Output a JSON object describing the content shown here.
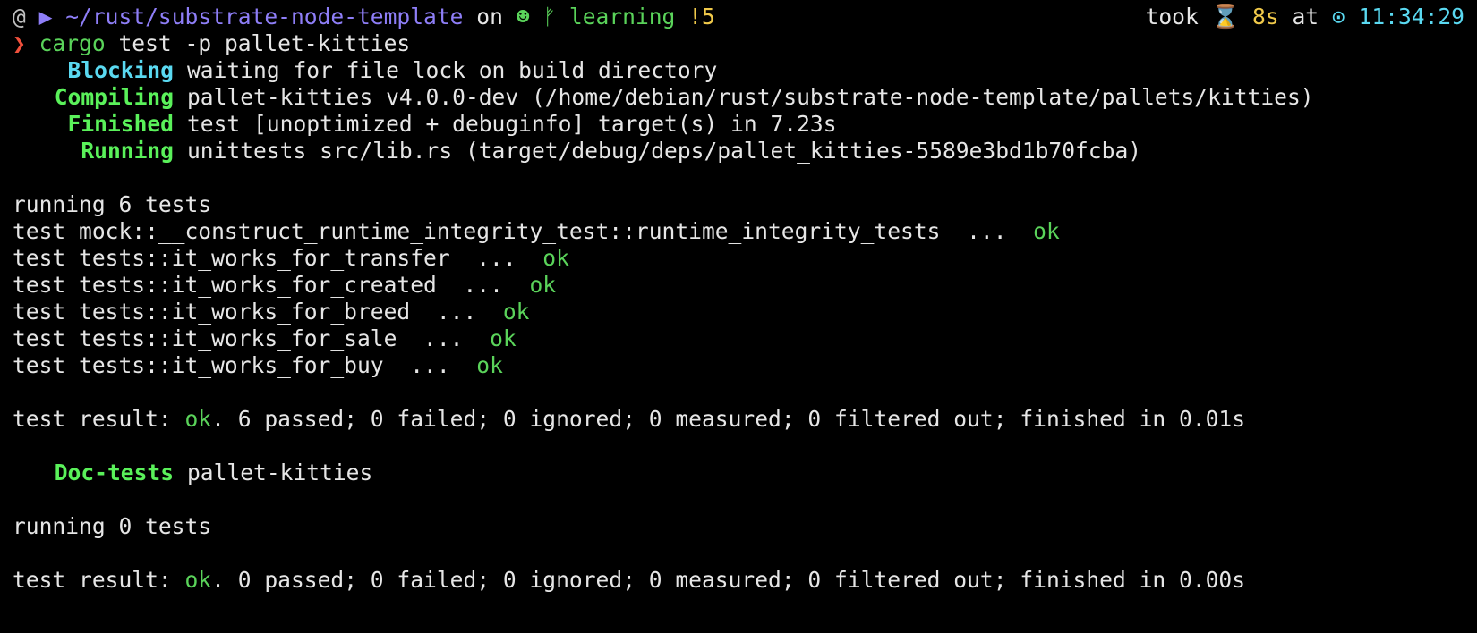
{
  "prompt": {
    "os_glyph": "@",
    "folder_glyph": "▶",
    "path": "~/rust/substrate-node-template",
    "on_word": "on",
    "git_glyph": "☻",
    "branch_glyph": "ᚠ",
    "branch": "learning",
    "status": "!5",
    "took_word": "took",
    "hourglass_glyph": "⌛",
    "duration": "8s",
    "at_word": "at",
    "clock_glyph": "⊙",
    "time": "11:34:29",
    "arrow_glyph": "❯",
    "command": "cargo",
    "args": "test -p pallet-kitties"
  },
  "cargo_status": [
    {
      "label": "Blocking",
      "text": "waiting for file lock on build directory",
      "color": "cyan"
    },
    {
      "label": "Compiling",
      "text": "pallet-kitties v4.0.0-dev (/home/debian/rust/substrate-node-template/pallets/kitties)",
      "color": "green"
    },
    {
      "label": "Finished",
      "text": "test [unoptimized + debuginfo] target(s) in 7.23s",
      "color": "green"
    },
    {
      "label": "Running",
      "text": "unittests src/lib.rs (target/debug/deps/pallet_kitties-5589e3bd1b70fcba)",
      "color": "green"
    }
  ],
  "unit_tests": {
    "running": "running 6 tests",
    "tests": [
      {
        "name": "test mock::__construct_runtime_integrity_test::runtime_integrity_tests",
        "dots": "...",
        "result": "ok"
      },
      {
        "name": "test tests::it_works_for_transfer",
        "dots": "...",
        "result": "ok"
      },
      {
        "name": "test tests::it_works_for_created",
        "dots": "...",
        "result": "ok"
      },
      {
        "name": "test tests::it_works_for_breed",
        "dots": "...",
        "result": "ok"
      },
      {
        "name": "test tests::it_works_for_sale",
        "dots": "...",
        "result": "ok"
      },
      {
        "name": "test tests::it_works_for_buy",
        "dots": "...",
        "result": "ok"
      }
    ],
    "result_prefix": "test result: ",
    "result_status": "ok",
    "result_rest": ". 6 passed; 0 failed; 0 ignored; 0 measured; 0 filtered out; finished in 0.01s"
  },
  "doc_tests": {
    "label": "Doc-tests",
    "name": "pallet-kitties",
    "running": "running 0 tests",
    "result_prefix": "test result: ",
    "result_status": "ok",
    "result_rest": ". 0 passed; 0 failed; 0 ignored; 0 measured; 0 filtered out; finished in 0.00s"
  },
  "colors": {
    "background": "#000000",
    "foreground": "#e6e6e6",
    "green": "#5af15a",
    "cyan": "#5ad9f1",
    "purple": "#8e7ef7",
    "yellow": "#f0c94a",
    "red": "#f0503c"
  }
}
